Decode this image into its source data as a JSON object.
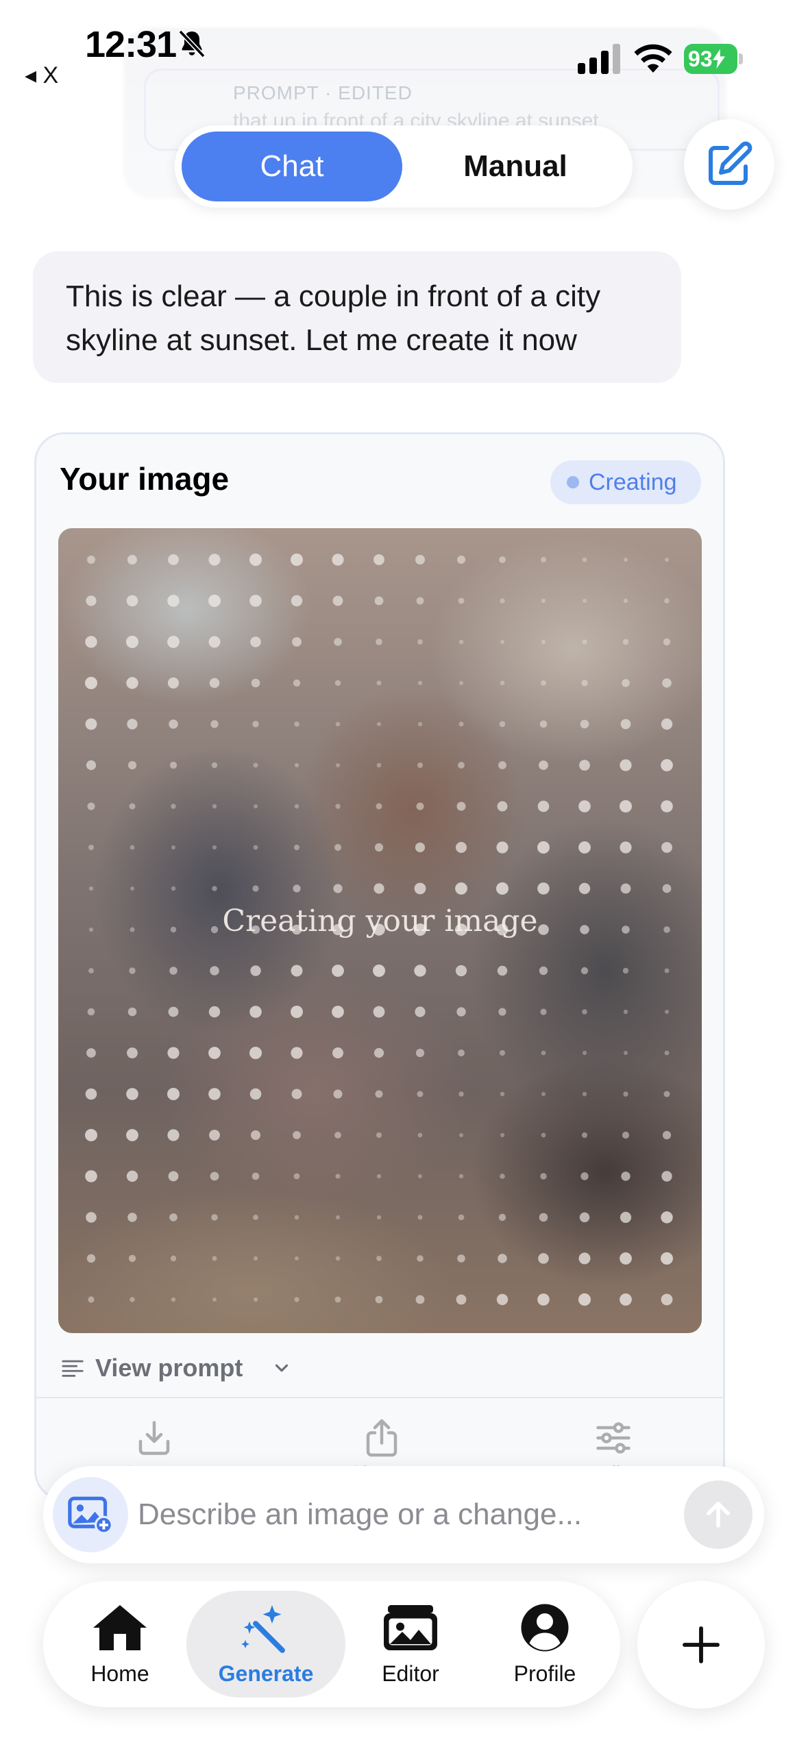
{
  "status_bar": {
    "time": "12:31",
    "back_app": "◂ X",
    "battery": "93"
  },
  "background_card": {
    "label": "PROMPT · EDITED",
    "text": "that up in front of a city skyline at sunset"
  },
  "mode_toggle": {
    "chat_label": "Chat",
    "manual_label": "Manual",
    "selected": "Chat"
  },
  "message": {
    "text": "This is clear — a couple in front of a city skyline at sunset. Let me create it now"
  },
  "image_card": {
    "title": "Your image",
    "status": "Creating",
    "preview_label": "Creating your image",
    "view_prompt_label": "View prompt",
    "actions": [
      "Save",
      "Share",
      "Edit"
    ]
  },
  "composer": {
    "placeholder": "Describe an image or a change..."
  },
  "tabbar": {
    "tabs": [
      {
        "label": "Home",
        "icon": "home-icon"
      },
      {
        "label": "Generate",
        "icon": "magic-wand-icon",
        "active": true
      },
      {
        "label": "Editor",
        "icon": "images-icon"
      },
      {
        "label": "Profile",
        "icon": "profile-icon"
      }
    ],
    "fab_icon": "plus-icon"
  },
  "colors": {
    "accent": "#4c7ff0",
    "active_tab": "#2a7de1",
    "battery": "#35c759",
    "badge_bg": "#e2e9fb"
  }
}
